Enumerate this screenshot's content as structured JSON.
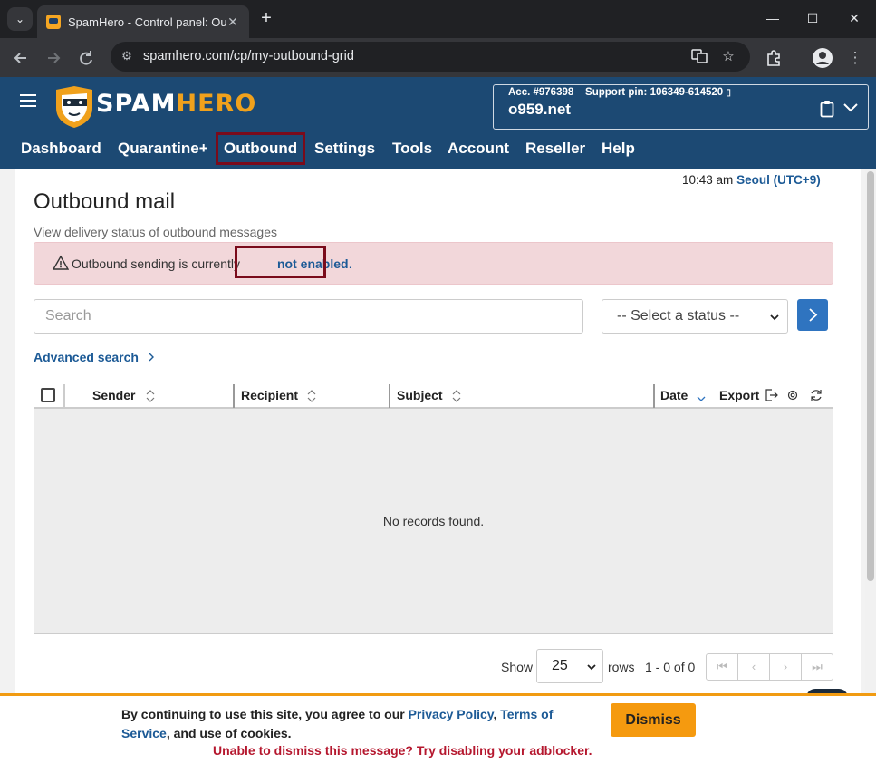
{
  "browser": {
    "tab_title": "SpamHero - Control panel: Ou",
    "tab_close": "✕",
    "new_tab": "+",
    "url": "spamhero.com/cp/my-outbound-grid",
    "window": {
      "minimize": "—",
      "maximize": "☐",
      "close": "✕"
    }
  },
  "header": {
    "logo_spam": "SPAM",
    "logo_hero": "HERO",
    "account_label": "Acc. #976398",
    "support_pin_label": "Support pin: 106349-614520",
    "domain": "o959.net"
  },
  "nav": {
    "items": [
      "Dashboard",
      "Quarantine+",
      "Outbound",
      "Settings",
      "Tools",
      "Account",
      "Reseller",
      "Help"
    ],
    "active": "Outbound"
  },
  "page": {
    "time": "10:43 am",
    "timezone": "Seoul (UTC+9)",
    "title": "Outbound mail",
    "subtitle": "View delivery status of outbound messages",
    "alert_text": "Outbound sending is currently",
    "alert_link": "not enabled",
    "alert_period": ".",
    "search_placeholder": "Search",
    "status_select": "-- Select a status --",
    "advanced_search": "Advanced search"
  },
  "grid": {
    "columns": [
      "Sender",
      "Recipient",
      "Subject",
      "Date"
    ],
    "export_label": "Export",
    "empty_message": "No records found."
  },
  "pager": {
    "show_label": "Show",
    "rows_value": "25",
    "rows_label": "rows",
    "range": "1 - 0 of 0"
  },
  "cookie": {
    "text_before": "By continuing to use this site, you agree to our ",
    "privacy_link": "Privacy Policy",
    "comma": ", ",
    "terms_link": "Terms of Service",
    "text_after": ", and use of cookies.",
    "adblock_warning": "Unable to dismiss this message? Try disabling your adblocker.",
    "dismiss_label": "Dismiss"
  },
  "colors": {
    "header_bg": "#1c4973",
    "brand_orange": "#f0a11c",
    "link_blue": "#1c5a96",
    "highlight_border": "#7a0b1b",
    "alert_bg": "#f2d7da",
    "button_blue": "#2f74c0"
  }
}
